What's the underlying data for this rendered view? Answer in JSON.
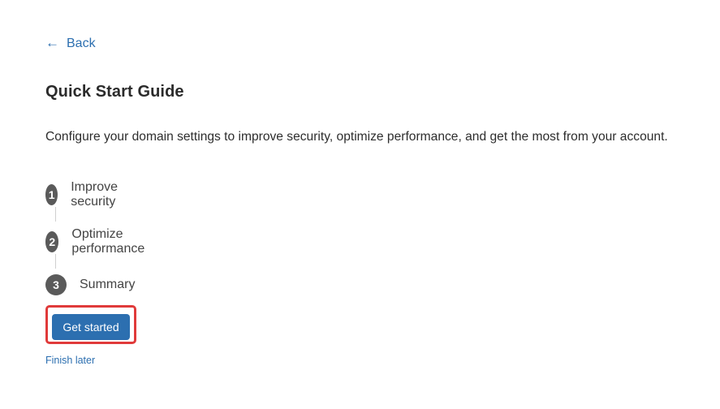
{
  "back": {
    "label": "Back"
  },
  "title": "Quick Start Guide",
  "description": "Configure your domain settings to improve security, optimize performance, and get the most from your account.",
  "steps": [
    {
      "number": "1",
      "label": "Improve security"
    },
    {
      "number": "2",
      "label": "Optimize performance"
    },
    {
      "number": "3",
      "label": "Summary"
    }
  ],
  "primary_button": {
    "label": "Get started"
  },
  "finish_later": {
    "label": "Finish later"
  },
  "colors": {
    "accent": "#2c6fb0",
    "step_circle": "#5a5a5a",
    "highlight_border": "#e03a3a"
  },
  "icons": {
    "back": "arrow-left-icon"
  }
}
